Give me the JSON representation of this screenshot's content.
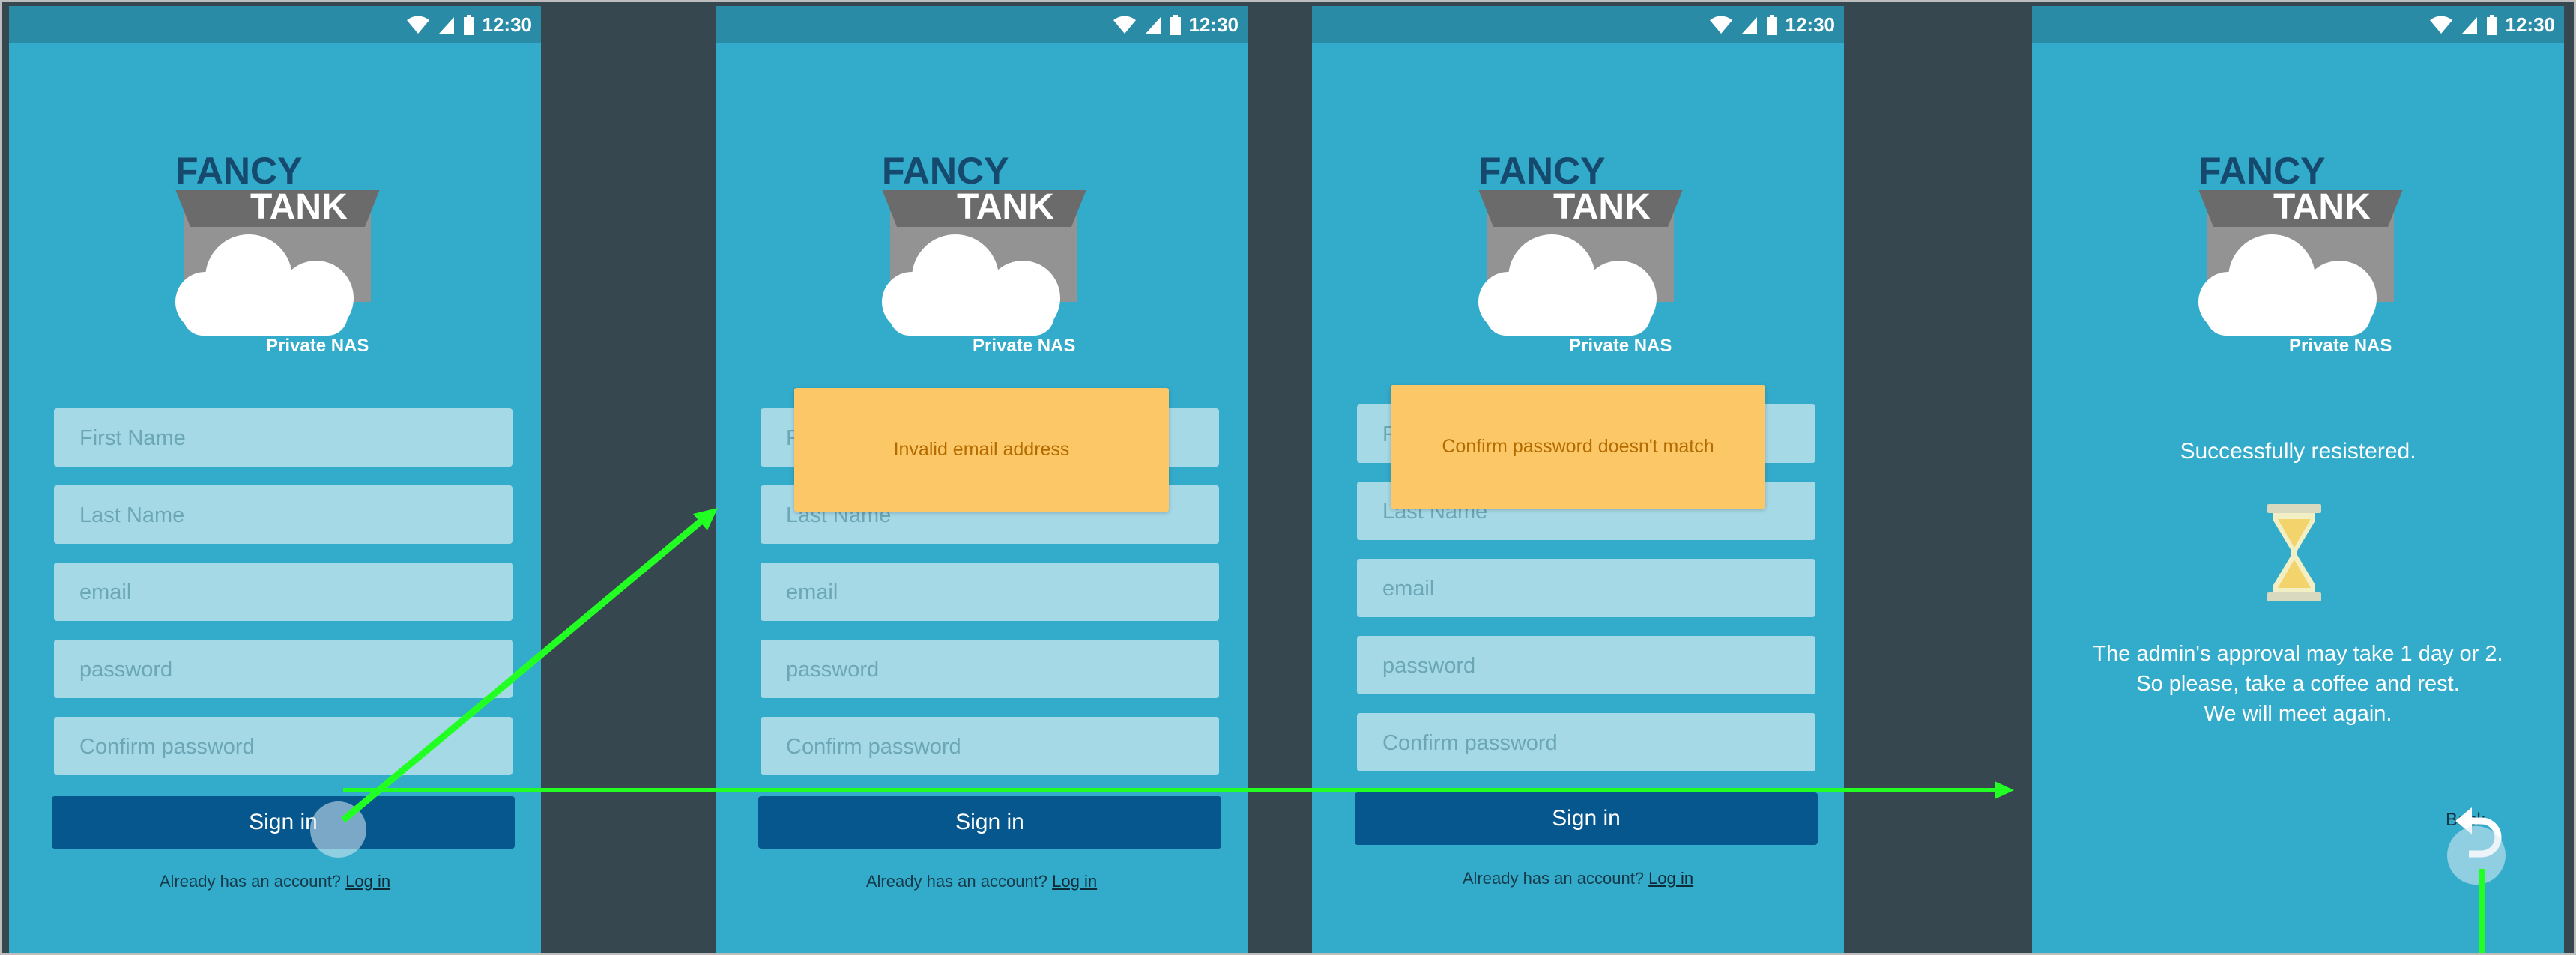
{
  "status_bar": {
    "time": "12:30"
  },
  "logo": {
    "line1": "FANCY",
    "line2": "TANK",
    "subtitle": "Private NAS"
  },
  "form": {
    "placeholders": [
      "First Name",
      "Last Name",
      "email",
      "password",
      "Confirm password"
    ],
    "partial_first_name": "F",
    "sign_in_label": "Sign in",
    "footer_text": "Already has an account?",
    "footer_link": "Log in"
  },
  "screen2": {
    "toast": "Invalid email address"
  },
  "screen3": {
    "toast": "Confirm password doesn't match"
  },
  "screen4": {
    "success": "Successfully resistered.",
    "line1": "The admin's approval may take 1 day or 2.",
    "line2": "So please, take a coffee and rest.",
    "line3": "We will meet again.",
    "back_label": "Back"
  },
  "colors": {
    "screen_bg": "#33abcb",
    "status_bar": "#2a8ba6",
    "button": "#05578d",
    "field": "#a6d9e6",
    "toast": "#fcc867",
    "arrow": "#22ff22",
    "gutter": "#37474f"
  },
  "icons": [
    "wifi-icon",
    "signal-icon",
    "battery-icon",
    "cloud-icon",
    "hourglass-icon",
    "back-arrow-icon"
  ]
}
